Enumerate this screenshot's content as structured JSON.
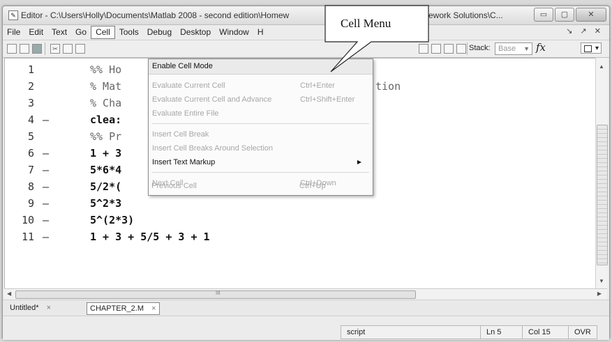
{
  "window": {
    "title": "Editor - C:\\Users\\Holly\\Documents\\Matlab 2008 - second edition\\Homew",
    "title_tail": "mework Solutions\\C...",
    "minimize": "▭",
    "maximize": "▢",
    "close": "✕"
  },
  "menubar": {
    "items": [
      "File",
      "Edit",
      "Text",
      "Go",
      "Cell",
      "Tools",
      "Debug",
      "Desktop",
      "Window",
      "H"
    ],
    "active": "Cell",
    "right_controls": "↘ ↗ ✕"
  },
  "toolbar": {
    "stack_label": "Stack:",
    "stack_value": "Base",
    "fx_label": "fx"
  },
  "editor": {
    "lines": [
      {
        "num": "1",
        "dash": "",
        "text": "%% Ho",
        "exec": false
      },
      {
        "num": "2",
        "dash": "",
        "text": "% Mat",
        "tail": "tion",
        "exec": false
      },
      {
        "num": "3",
        "dash": "",
        "text": "% Cha",
        "exec": false
      },
      {
        "num": "4",
        "dash": "—",
        "text": "clea:",
        "exec": true
      },
      {
        "num": "5",
        "dash": "",
        "text": "%% Pr",
        "exec": false
      },
      {
        "num": "6",
        "dash": "—",
        "text": "1 + 3",
        "exec": true
      },
      {
        "num": "7",
        "dash": "—",
        "text": "5*6*4",
        "exec": true
      },
      {
        "num": "8",
        "dash": "—",
        "text": "5/2*(",
        "exec": true
      },
      {
        "num": "9",
        "dash": "—",
        "text": "5^2*3",
        "exec": true
      },
      {
        "num": "10",
        "dash": "—",
        "text": "5^(2*3)",
        "exec": true
      },
      {
        "num": "11",
        "dash": "—",
        "text": "1 + 3 + 5/5 + 3 + 1",
        "exec": true
      }
    ]
  },
  "cell_menu": {
    "items": [
      {
        "label": "Enable Cell Mode",
        "shortcut": "",
        "enabled": true,
        "header": true
      },
      {
        "label": "Evaluate Current Cell",
        "shortcut": "Ctrl+Enter",
        "enabled": false
      },
      {
        "label": "Evaluate Current Cell and Advance",
        "shortcut": "Ctrl+Shift+Enter",
        "enabled": false
      },
      {
        "label": "Evaluate Entire File",
        "shortcut": "",
        "enabled": false
      },
      {
        "label": "Insert Cell Break",
        "shortcut": "",
        "enabled": false
      },
      {
        "label": "Insert Cell Breaks Around Selection",
        "shortcut": "",
        "enabled": false
      },
      {
        "label": "Insert Text Markup",
        "shortcut": "",
        "enabled": true,
        "submenu": true
      },
      {
        "label": "Next Cell",
        "shortcut": "Ctrl+Down",
        "enabled": false
      },
      {
        "label": "Previous Cell",
        "shortcut": "Ctrl+Up",
        "enabled": false
      }
    ]
  },
  "callout": {
    "text": "Cell Menu"
  },
  "hscroll": {
    "grip": "III"
  },
  "tabs": [
    {
      "label": "Untitled*",
      "close": "×",
      "active": false
    },
    {
      "label": "CHAPTER_2.M",
      "close": "×",
      "active": true
    }
  ],
  "statusbar": {
    "mode": "script",
    "line": "Ln  5",
    "col": "Col  15",
    "ovr": "OVR"
  }
}
